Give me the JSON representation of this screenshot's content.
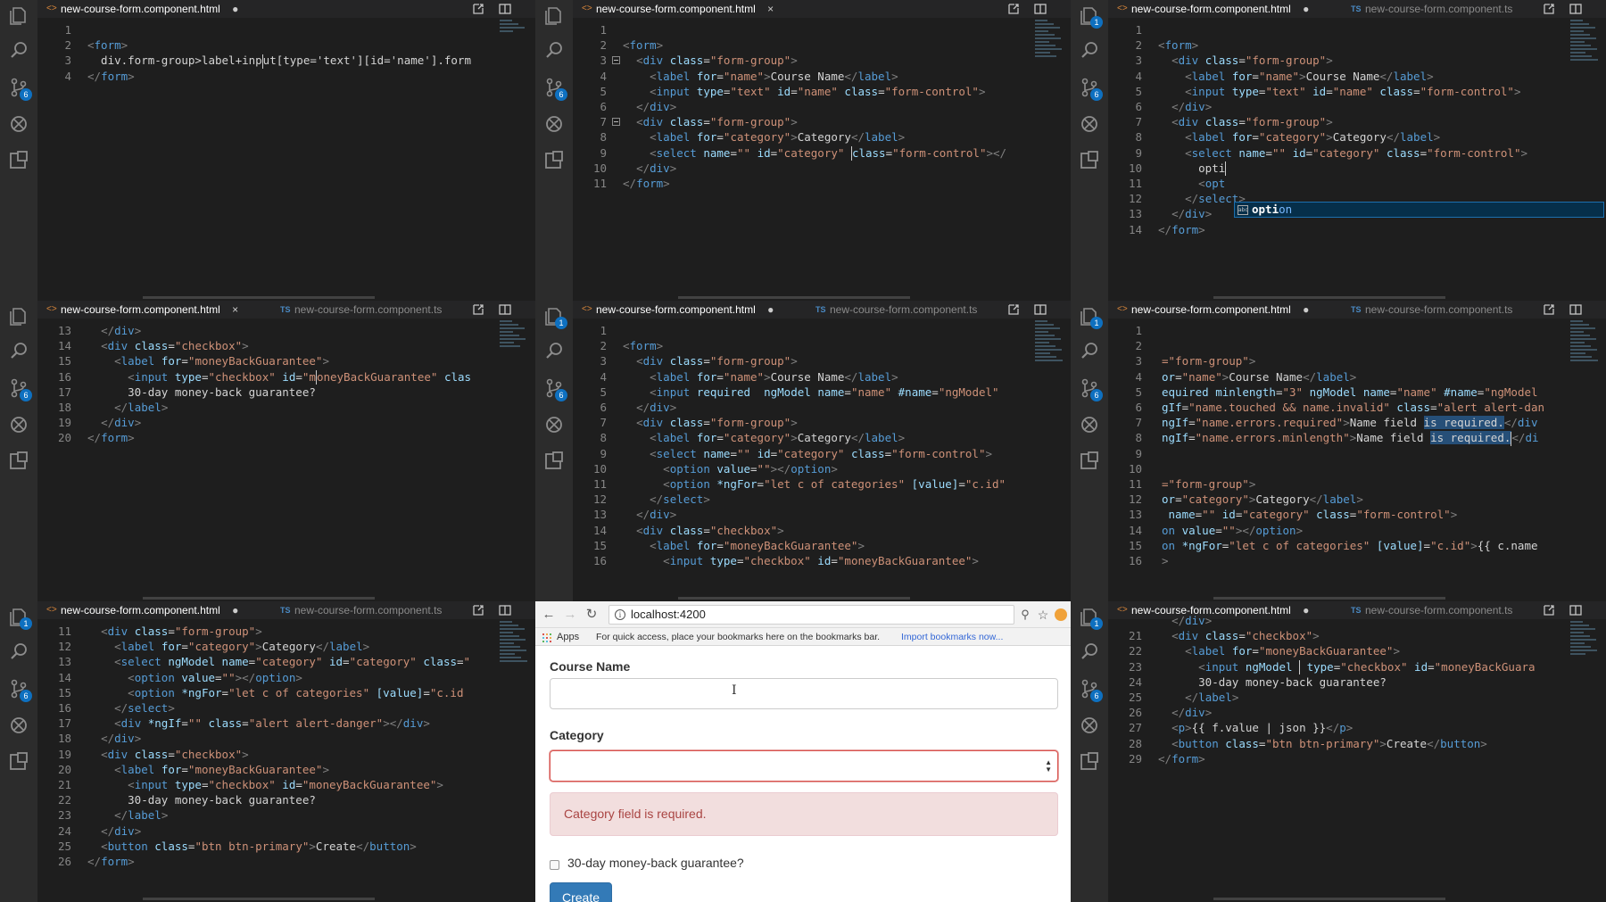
{
  "tabs": {
    "html": "new-course-form.component.html",
    "ts": "new-course-form.component.ts",
    "close_mark": "×",
    "dirty_mark": "●",
    "ts_icon": "TS",
    "html_icon": "<>"
  },
  "badges": {
    "six": "6",
    "one": "1"
  },
  "panel1": {
    "lines": [
      {
        "n": "1",
        "h": ""
      },
      {
        "n": "2",
        "h": "<span class='p'>&lt;</span><span class='t'>form</span><span class='p'>&gt;</span>"
      },
      {
        "n": "3",
        "h": "  div.form-group&gt;label+inp<span class='cursor'></span>ut[type='text'][id='name'].form"
      },
      {
        "n": "4",
        "h": "<span class='p'>&lt;/</span><span class='t'>form</span><span class='p'>&gt;</span>"
      }
    ]
  },
  "panel2": {
    "lines": [
      {
        "n": "1",
        "h": ""
      },
      {
        "n": "2",
        "h": "<span class='p'>&lt;</span><span class='t'>form</span><span class='p'>&gt;</span>"
      },
      {
        "n": "3",
        "h": "  <span class='p'>&lt;</span><span class='t'>div</span> <span class='a'>class</span>=<span class='s'>\"form-group\"</span><span class='p'>&gt;</span>"
      },
      {
        "n": "4",
        "h": "    <span class='p'>&lt;</span><span class='t'>label</span> <span class='a'>for</span>=<span class='s'>\"name\"</span><span class='p'>&gt;</span>Course Name<span class='p'>&lt;/</span><span class='t'>label</span><span class='p'>&gt;</span>"
      },
      {
        "n": "5",
        "h": "    <span class='p'>&lt;</span><span class='t'>input</span> <span class='a'>type</span>=<span class='s'>\"text\"</span> <span class='a'>id</span>=<span class='s'>\"name\"</span> <span class='a'>class</span>=<span class='s'>\"form-control\"</span><span class='p'>&gt;</span>"
      },
      {
        "n": "6",
        "h": "  <span class='p'>&lt;/</span><span class='t'>div</span><span class='p'>&gt;</span>"
      },
      {
        "n": "7",
        "h": "  <span class='p'>&lt;</span><span class='t'>div</span> <span class='a'>class</span>=<span class='s'>\"form-group\"</span><span class='p'>&gt;</span>"
      },
      {
        "n": "8",
        "h": "    <span class='p'>&lt;</span><span class='t'>label</span> <span class='a'>for</span>=<span class='s'>\"category\"</span><span class='p'>&gt;</span>Category<span class='p'>&lt;/</span><span class='t'>label</span><span class='p'>&gt;</span>"
      },
      {
        "n": "9",
        "h": "    <span class='p'>&lt;</span><span class='t'>select</span> <span class='a'>name</span>=<span class='s'>\"\"</span> <span class='a'>id</span>=<span class='s'>\"category\"</span> <span class='cursor'></span><span class='a'>class</span>=<span class='s'>\"form-control\"</span><span class='p'>&gt;&lt;/</span>"
      },
      {
        "n": "10",
        "h": "  <span class='p'>&lt;/</span><span class='t'>div</span><span class='p'>&gt;</span>"
      },
      {
        "n": "11",
        "h": "<span class='p'>&lt;/</span><span class='t'>form</span><span class='p'>&gt;</span>"
      }
    ]
  },
  "panel3": {
    "lines": [
      {
        "n": "1",
        "h": ""
      },
      {
        "n": "2",
        "h": "<span class='p'>&lt;</span><span class='t'>form</span><span class='p'>&gt;</span>"
      },
      {
        "n": "3",
        "h": "  <span class='p'>&lt;</span><span class='t'>div</span> <span class='a'>class</span>=<span class='s'>\"form-group\"</span><span class='p'>&gt;</span>"
      },
      {
        "n": "4",
        "h": "    <span class='p'>&lt;</span><span class='t'>label</span> <span class='a'>for</span>=<span class='s'>\"name\"</span><span class='p'>&gt;</span>Course Name<span class='p'>&lt;/</span><span class='t'>label</span><span class='p'>&gt;</span>"
      },
      {
        "n": "5",
        "h": "    <span class='p'>&lt;</span><span class='t'>input</span> <span class='a'>type</span>=<span class='s'>\"text\"</span> <span class='a'>id</span>=<span class='s'>\"name\"</span> <span class='a'>class</span>=<span class='s'>\"form-control\"</span><span class='p'>&gt;</span>"
      },
      {
        "n": "6",
        "h": "  <span class='p'>&lt;/</span><span class='t'>div</span><span class='p'>&gt;</span>"
      },
      {
        "n": "7",
        "h": "  <span class='p'>&lt;</span><span class='t'>div</span> <span class='a'>class</span>=<span class='s'>\"form-group\"</span><span class='p'>&gt;</span>"
      },
      {
        "n": "8",
        "h": "    <span class='p'>&lt;</span><span class='t'>label</span> <span class='a'>for</span>=<span class='s'>\"category\"</span><span class='p'>&gt;</span>Category<span class='p'>&lt;/</span><span class='t'>label</span><span class='p'>&gt;</span>"
      },
      {
        "n": "9",
        "h": "    <span class='p'>&lt;</span><span class='t'>select</span> <span class='a'>name</span>=<span class='s'>\"\"</span> <span class='a'>id</span>=<span class='s'>\"category\"</span> <span class='a'>class</span>=<span class='s'>\"form-control\"</span><span class='p'>&gt;</span>"
      },
      {
        "n": "10",
        "h": "      opti<span class='cursor'></span>"
      },
      {
        "n": "11",
        "h": "      <span class='p'>&lt;</span><span class='t'>opt</span>"
      },
      {
        "n": "12",
        "h": "    <span class='p'>&lt;/</span><span class='t'>select</span><span class='p'>&gt;</span>"
      },
      {
        "n": "13",
        "h": "  <span class='p'>&lt;/</span><span class='t'>div</span><span class='p'>&gt;</span>"
      },
      {
        "n": "14",
        "h": "<span class='p'>&lt;/</span><span class='t'>form</span><span class='p'>&gt;</span>"
      }
    ],
    "suggest_match": "opti",
    "suggest_rest": "on"
  },
  "panel4": {
    "lines": [
      {
        "n": "13",
        "h": "  <span class='p'>&lt;/</span><span class='t'>div</span><span class='p'>&gt;</span>"
      },
      {
        "n": "14",
        "h": "  <span class='p'>&lt;</span><span class='t'>div</span> <span class='a'>class</span>=<span class='s'>\"checkbox\"</span><span class='p'>&gt;</span>"
      },
      {
        "n": "15",
        "h": "    <span class='p'>&lt;</span><span class='t'>label</span> <span class='a'>for</span>=<span class='s'>\"moneyBackGuarantee\"</span><span class='p'>&gt;</span>"
      },
      {
        "n": "16",
        "h": "      <span class='p'>&lt;</span><span class='t'>input</span> <span class='a'>type</span>=<span class='s'>\"checkbox\"</span> <span class='a'>id</span>=<span class='s'>\"m<span class='cursor'></span>oneyBackGuarantee\"</span> <span class='a'>clas</span>"
      },
      {
        "n": "17",
        "h": "      30-day money-back guarantee?"
      },
      {
        "n": "18",
        "h": "    <span class='p'>&lt;/</span><span class='t'>label</span><span class='p'>&gt;</span>"
      },
      {
        "n": "19",
        "h": "  <span class='p'>&lt;/</span><span class='t'>div</span><span class='p'>&gt;</span>"
      },
      {
        "n": "20",
        "h": "<span class='p'>&lt;/</span><span class='t'>form</span><span class='p'>&gt;</span>"
      }
    ]
  },
  "panel5": {
    "lines": [
      {
        "n": "1",
        "h": ""
      },
      {
        "n": "2",
        "h": "<span class='p'>&lt;</span><span class='t'>form</span><span class='p'>&gt;</span>"
      },
      {
        "n": "3",
        "h": "  <span class='p'>&lt;</span><span class='t'>div</span> <span class='a'>class</span>=<span class='s'>\"form-group\"</span><span class='p'>&gt;</span>"
      },
      {
        "n": "4",
        "h": "    <span class='p'>&lt;</span><span class='t'>label</span> <span class='a'>for</span>=<span class='s'>\"name\"</span><span class='p'>&gt;</span>Course Name<span class='p'>&lt;/</span><span class='t'>label</span><span class='p'>&gt;</span>"
      },
      {
        "n": "5",
        "h": "    <span class='p'>&lt;</span><span class='t'>input</span> <span class='a'>required</span>  <span class='a'>ngModel</span> <span class='a'>name</span>=<span class='s'>\"name\"</span> <span class='a'>#name</span>=<span class='s'>\"ngModel\"</span>"
      },
      {
        "n": "6",
        "h": "  <span class='p'>&lt;/</span><span class='t'>div</span><span class='p'>&gt;</span>"
      },
      {
        "n": "7",
        "h": "  <span class='p'>&lt;</span><span class='t'>div</span> <span class='a'>class</span>=<span class='s'>\"form-group\"</span><span class='p'>&gt;</span>"
      },
      {
        "n": "8",
        "h": "    <span class='p'>&lt;</span><span class='t'>label</span> <span class='a'>for</span>=<span class='s'>\"category\"</span><span class='p'>&gt;</span>Category<span class='p'>&lt;/</span><span class='t'>label</span><span class='p'>&gt;</span>"
      },
      {
        "n": "9",
        "h": "    <span class='p'>&lt;</span><span class='t'>select</span> <span class='a'>name</span>=<span class='s'>\"\"</span> <span class='a'>id</span>=<span class='s'>\"category\"</span> <span class='a'>class</span>=<span class='s'>\"form-control\"</span><span class='p'>&gt;</span>"
      },
      {
        "n": "10",
        "h": "      <span class='p'>&lt;</span><span class='t'>option</span> <span class='a'>value</span>=<span class='s'>\"\"</span><span class='p'>&gt;&lt;/</span><span class='t'>option</span><span class='p'>&gt;</span>"
      },
      {
        "n": "11",
        "h": "      <span class='p'>&lt;</span><span class='t'>option</span> <span class='a'>*ngFor</span>=<span class='s'>\"let c of categories\"</span> <span class='a'>[value]</span>=<span class='s'>\"c.id\"</span>"
      },
      {
        "n": "12",
        "h": "    <span class='p'>&lt;/</span><span class='t'>select</span><span class='p'>&gt;</span>"
      },
      {
        "n": "13",
        "h": "  <span class='p'>&lt;/</span><span class='t'>div</span><span class='p'>&gt;</span>"
      },
      {
        "n": "14",
        "h": "  <span class='p'>&lt;</span><span class='t'>div</span> <span class='a'>class</span>=<span class='s'>\"checkbox\"</span><span class='p'>&gt;</span>"
      },
      {
        "n": "15",
        "h": "    <span class='p'>&lt;</span><span class='t'>label</span> <span class='a'>for</span>=<span class='s'>\"moneyBackGuarantee\"</span><span class='p'>&gt;</span>"
      },
      {
        "n": "16",
        "h": "      <span class='p'>&lt;</span><span class='t'>input</span> <span class='a'>type</span>=<span class='s'>\"checkbox\"</span> <span class='a'>id</span>=<span class='s'>\"moneyBackGuarantee\"</span><span class='p'>&gt;</span>"
      }
    ]
  },
  "panel6": {
    "lines": [
      {
        "n": "1",
        "h": ""
      },
      {
        "n": "2",
        "h": ""
      },
      {
        "n": "3",
        "h": "<span class='s'>=\"form-group\"</span><span class='p'>&gt;</span>"
      },
      {
        "n": "4",
        "h": "<span class='a'>or</span>=<span class='s'>\"name\"</span><span class='p'>&gt;</span>Course Name<span class='p'>&lt;/</span><span class='t'>label</span><span class='p'>&gt;</span>"
      },
      {
        "n": "5",
        "h": "<span class='a'>equired</span> <span class='a'>minlength</span>=<span class='s'>\"3\"</span> <span class='a'>ngModel</span> <span class='a'>name</span>=<span class='s'>\"name\"</span> <span class='a'>#name</span>=<span class='s'>\"ngModel</span>"
      },
      {
        "n": "6",
        "h": "<span class='a'>gIf</span>=<span class='s'>\"name.touched &amp;&amp; name.invalid\"</span> <span class='a'>class</span>=<span class='s'>\"alert alert-dan</span>"
      },
      {
        "n": "7",
        "h": "<span class='a'>ngIf</span>=<span class='s'>\"name.errors.required\"</span><span class='p'>&gt;</span>Name field <span class='hl'>is required.</span><span class='p'>&lt;/</span><span class='t'>div</span>"
      },
      {
        "n": "8",
        "h": "<span class='a'>ngIf</span>=<span class='s'>\"name.errors.minlength\"</span><span class='p'>&gt;</span>Name field <span class='hl'>is required.<span class='cursor'></span></span><span class='p'>&lt;/</span><span class='t'>di</span>"
      },
      {
        "n": "9",
        "h": ""
      },
      {
        "n": "10",
        "h": ""
      },
      {
        "n": "11",
        "h": "<span class='s'>=\"form-group\"</span><span class='p'>&gt;</span>"
      },
      {
        "n": "12",
        "h": "<span class='a'>or</span>=<span class='s'>\"category\"</span><span class='p'>&gt;</span>Category<span class='p'>&lt;/</span><span class='t'>label</span><span class='p'>&gt;</span>"
      },
      {
        "n": "13",
        "h": " <span class='a'>name</span>=<span class='s'>\"\"</span> <span class='a'>id</span>=<span class='s'>\"category\"</span> <span class='a'>class</span>=<span class='s'>\"form-control\"</span><span class='p'>&gt;</span>"
      },
      {
        "n": "14",
        "h": "<span class='t'>on</span> <span class='a'>value</span>=<span class='s'>\"\"</span><span class='p'>&gt;&lt;/</span><span class='t'>option</span><span class='p'>&gt;</span>"
      },
      {
        "n": "15",
        "h": "<span class='t'>on</span> <span class='a'>*ngFor</span>=<span class='s'>\"let c of categories\"</span> <span class='a'>[value]</span>=<span class='s'>\"c.id\"</span><span class='p'>&gt;</span>{{ c.name"
      },
      {
        "n": "16",
        "h": "<span class='p'>&gt;</span>"
      }
    ]
  },
  "panel7": {
    "lines": [
      {
        "n": "11",
        "h": "  <span class='p'>&lt;</span><span class='t'>div</span> <span class='a'>class</span>=<span class='s'>\"form-group\"</span><span class='p'>&gt;</span>"
      },
      {
        "n": "12",
        "h": "    <span class='p'>&lt;</span><span class='t'>label</span> <span class='a'>for</span>=<span class='s'>\"category\"</span><span class='p'>&gt;</span>Category<span class='p'>&lt;/</span><span class='t'>label</span><span class='p'>&gt;</span>"
      },
      {
        "n": "13",
        "h": "    <span class='p'>&lt;</span><span class='t'>select</span> <span class='a'>ngModel</span> <span class='a'>name</span>=<span class='s'>\"category\"</span> <span class='a'>id</span>=<span class='s'>\"category\"</span> <span class='a'>class</span>=<span class='s'>\"</span>"
      },
      {
        "n": "14",
        "h": "      <span class='p'>&lt;</span><span class='t'>option</span> <span class='a'>value</span>=<span class='s'>\"\"</span><span class='p'>&gt;&lt;/</span><span class='t'>option</span><span class='p'>&gt;</span>"
      },
      {
        "n": "15",
        "h": "      <span class='p'>&lt;</span><span class='t'>option</span> <span class='a'>*ngFor</span>=<span class='s'>\"let c of categories\"</span> <span class='a'>[value]</span>=<span class='s'>\"c.id</span>"
      },
      {
        "n": "16",
        "h": "    <span class='p'>&lt;/</span><span class='t'>select</span><span class='p'>&gt;</span>"
      },
      {
        "n": "17",
        "h": "    <span class='p'>&lt;</span><span class='t'>div</span> <span class='a'>*ngIf</span>=<span class='s'>\"\"</span> <span class='a'>class</span>=<span class='s'>\"alert alert-danger\"</span><span class='p'>&gt;&lt;/</span><span class='t'>div</span><span class='p'>&gt;</span>"
      },
      {
        "n": "18",
        "h": "  <span class='p'>&lt;/</span><span class='t'>div</span><span class='p'>&gt;</span>"
      },
      {
        "n": "19",
        "h": "  <span class='p'>&lt;</span><span class='t'>div</span> <span class='a'>class</span>=<span class='s'>\"checkbox\"</span><span class='p'>&gt;</span>"
      },
      {
        "n": "20",
        "h": "    <span class='p'>&lt;</span><span class='t'>label</span> <span class='a'>for</span>=<span class='s'>\"moneyBackGuarantee\"</span><span class='p'>&gt;</span>"
      },
      {
        "n": "21",
        "h": "      <span class='p'>&lt;</span><span class='t'>input</span> <span class='a'>type</span>=<span class='s'>\"checkbox\"</span> <span class='a'>id</span>=<span class='s'>\"moneyBackGuarantee\"</span><span class='p'>&gt;</span>"
      },
      {
        "n": "22",
        "h": "      30-day money-back guarantee?"
      },
      {
        "n": "23",
        "h": "    <span class='p'>&lt;/</span><span class='t'>label</span><span class='p'>&gt;</span>"
      },
      {
        "n": "24",
        "h": "  <span class='p'>&lt;/</span><span class='t'>div</span><span class='p'>&gt;</span>"
      },
      {
        "n": "25",
        "h": "  <span class='p'>&lt;</span><span class='t'>button</span> <span class='a'>class</span>=<span class='s'>\"btn btn-primary\"</span><span class='p'>&gt;</span>Create<span class='p'>&lt;/</span><span class='t'>button</span><span class='p'>&gt;</span>"
      },
      {
        "n": "26",
        "h": "<span class='p'>&lt;/</span><span class='t'>form</span><span class='p'>&gt;</span>"
      }
    ]
  },
  "panel9": {
    "lines": [
      {
        "n": "",
        "h": "  <span class='p'>&lt;/</span><span class='t'>div</span><span class='p'>&gt;</span>"
      },
      {
        "n": "21",
        "h": "  <span class='p'>&lt;</span><span class='t'>div</span> <span class='a'>class</span>=<span class='s'>\"checkbox\"</span><span class='p'>&gt;</span>"
      },
      {
        "n": "22",
        "h": "    <span class='p'>&lt;</span><span class='t'>label</span> <span class='a'>for</span>=<span class='s'>\"moneyBackGuarantee\"</span><span class='p'>&gt;</span>"
      },
      {
        "n": "23",
        "h": "      <span class='p'>&lt;</span><span class='t'>input</span> <span class='a'>ngModel</span> <span class='cursor'></span> <span class='a'>type</span>=<span class='s'>\"checkbox\"</span> <span class='a'>id</span>=<span class='s'>\"moneyBackGuara</span>"
      },
      {
        "n": "24",
        "h": "      30-day money-back guarantee?"
      },
      {
        "n": "25",
        "h": "    <span class='p'>&lt;/</span><span class='t'>label</span><span class='p'>&gt;</span>"
      },
      {
        "n": "26",
        "h": "  <span class='p'>&lt;/</span><span class='t'>div</span><span class='p'>&gt;</span>"
      },
      {
        "n": "27",
        "h": "  <span class='p'>&lt;</span><span class='t'>p</span><span class='p'>&gt;</span>{{ f.value | json }}<span class='p'>&lt;/</span><span class='t'>p</span><span class='p'>&gt;</span>"
      },
      {
        "n": "28",
        "h": "  <span class='p'>&lt;</span><span class='t'>button</span> <span class='a'>class</span>=<span class='s'>\"btn btn-primary\"</span><span class='p'>&gt;</span>Create<span class='p'>&lt;/</span><span class='t'>button</span><span class='p'>&gt;</span>"
      },
      {
        "n": "29",
        "h": "<span class='p'>&lt;/</span><span class='t'>form</span><span class='p'>&gt;</span>"
      }
    ]
  },
  "browser": {
    "url": "localhost:4200",
    "bookmarks_apps": "Apps",
    "bookmarks_hint": "For quick access, place your bookmarks here on the bookmarks bar.",
    "bookmarks_import": "Import bookmarks now...",
    "course_name_label": "Course Name",
    "category_label": "Category",
    "category_error": "Category field is required.",
    "checkbox_label": "30-day money-back guarantee?",
    "create_button": "Create",
    "colors": {
      "primary": "#337ab7",
      "danger_text": "#a94442",
      "danger_bg": "#f2dede"
    }
  }
}
